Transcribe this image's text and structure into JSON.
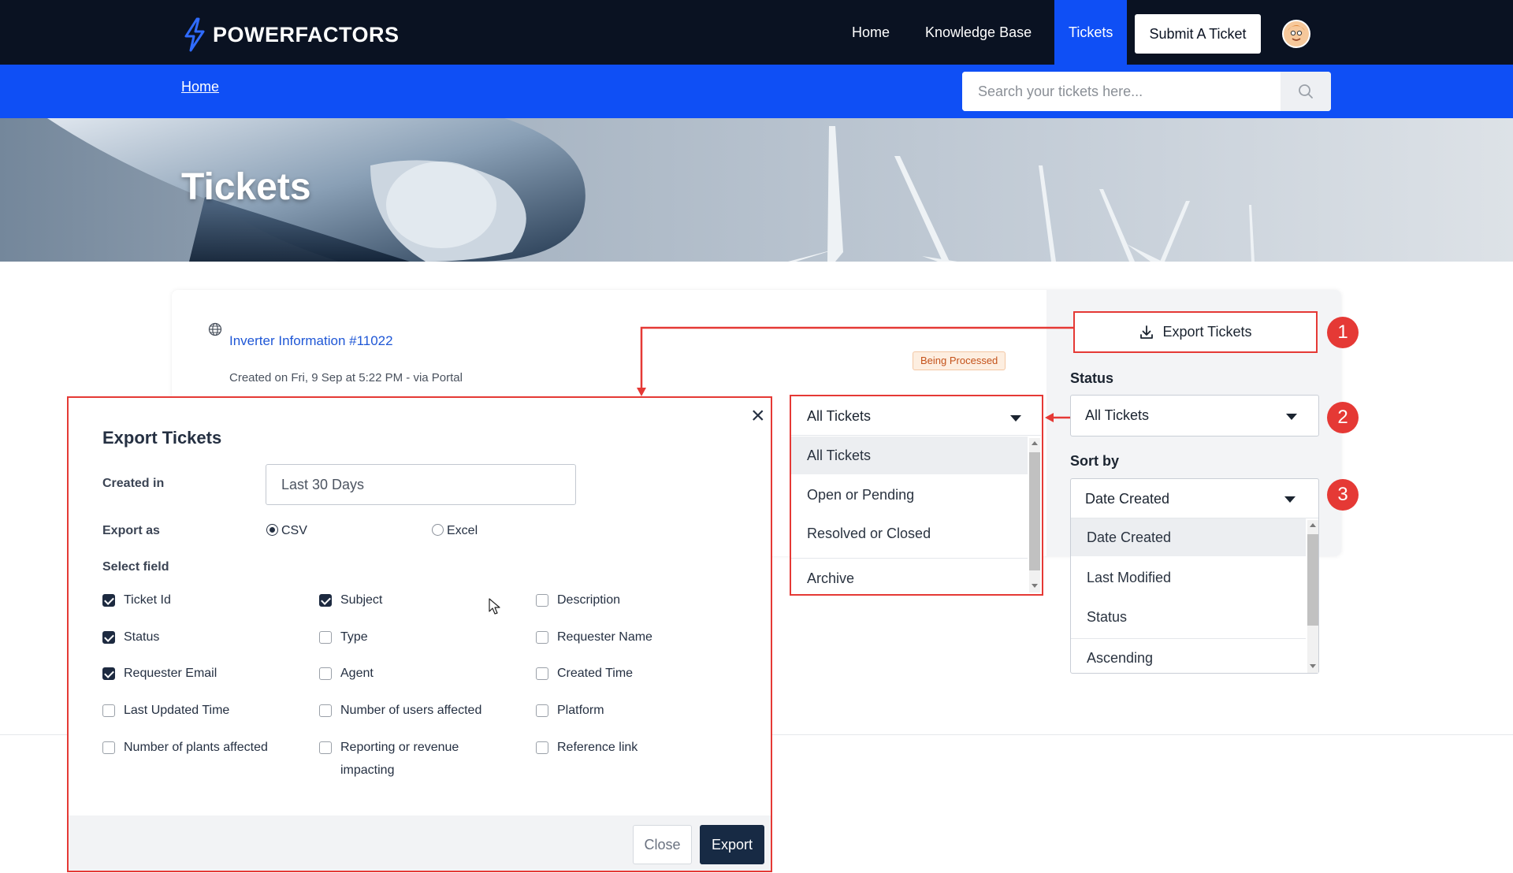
{
  "brand": {
    "name": "POWERFACTORS"
  },
  "nav": {
    "home": "Home",
    "knowledge_base": "Knowledge Base",
    "tickets": "Tickets",
    "submit": "Submit A Ticket"
  },
  "breadcrumb": {
    "home": "Home"
  },
  "search": {
    "placeholder": "Search your tickets here..."
  },
  "hero": {
    "title": "Tickets"
  },
  "ticket": {
    "title": "Inverter Information #11022",
    "meta": "Created on Fri, 9 Sep at 5:22 PM - via Portal",
    "status_badge": "Being Processed"
  },
  "sidebar": {
    "export_label": "Export Tickets",
    "status_label": "Status",
    "status_value": "All Tickets",
    "sort_label": "Sort by",
    "sort_value": "Date Created"
  },
  "status_dropdown": {
    "value": "All Tickets",
    "options": [
      "All Tickets",
      "Open or Pending",
      "Resolved or Closed",
      "Archive"
    ]
  },
  "sort_dropdown": {
    "options": [
      "Date Created",
      "Last Modified",
      "Status",
      "Ascending"
    ]
  },
  "callouts": [
    "1",
    "2",
    "3"
  ],
  "modal": {
    "title": "Export Tickets",
    "created_in_label": "Created in",
    "created_in_value": "Last 30 Days",
    "export_as_label": "Export as",
    "formats": [
      {
        "label": "CSV",
        "selected": true
      },
      {
        "label": "Excel",
        "selected": false
      }
    ],
    "select_field_label": "Select field",
    "fields": [
      {
        "label": "Ticket Id",
        "checked": true
      },
      {
        "label": "Subject",
        "checked": true
      },
      {
        "label": "Description",
        "checked": false
      },
      {
        "label": "Status",
        "checked": true
      },
      {
        "label": "Type",
        "checked": false
      },
      {
        "label": "Requester Name",
        "checked": false
      },
      {
        "label": "Requester Email",
        "checked": true
      },
      {
        "label": "Agent",
        "checked": false
      },
      {
        "label": "Created Time",
        "checked": false
      },
      {
        "label": "Last Updated Time",
        "checked": false
      },
      {
        "label": "Number of users affected",
        "checked": false
      },
      {
        "label": "Platform",
        "checked": false
      },
      {
        "label": "Number of plants affected",
        "checked": false
      },
      {
        "label": "Reporting or revenue impacting",
        "checked": false
      },
      {
        "label": "Reference link",
        "checked": false
      }
    ],
    "close_label": "Close",
    "export_label": "Export"
  },
  "colors": {
    "navy": "#0a1222",
    "brand_blue": "#0f4ff5",
    "callout_red": "#e53935",
    "export_button": "#172a44"
  },
  "icons": [
    "bolt-logo-icon",
    "search-icon",
    "globe-icon",
    "download-icon",
    "close-icon",
    "caret-down-icon",
    "mouse-cursor-icon"
  ]
}
